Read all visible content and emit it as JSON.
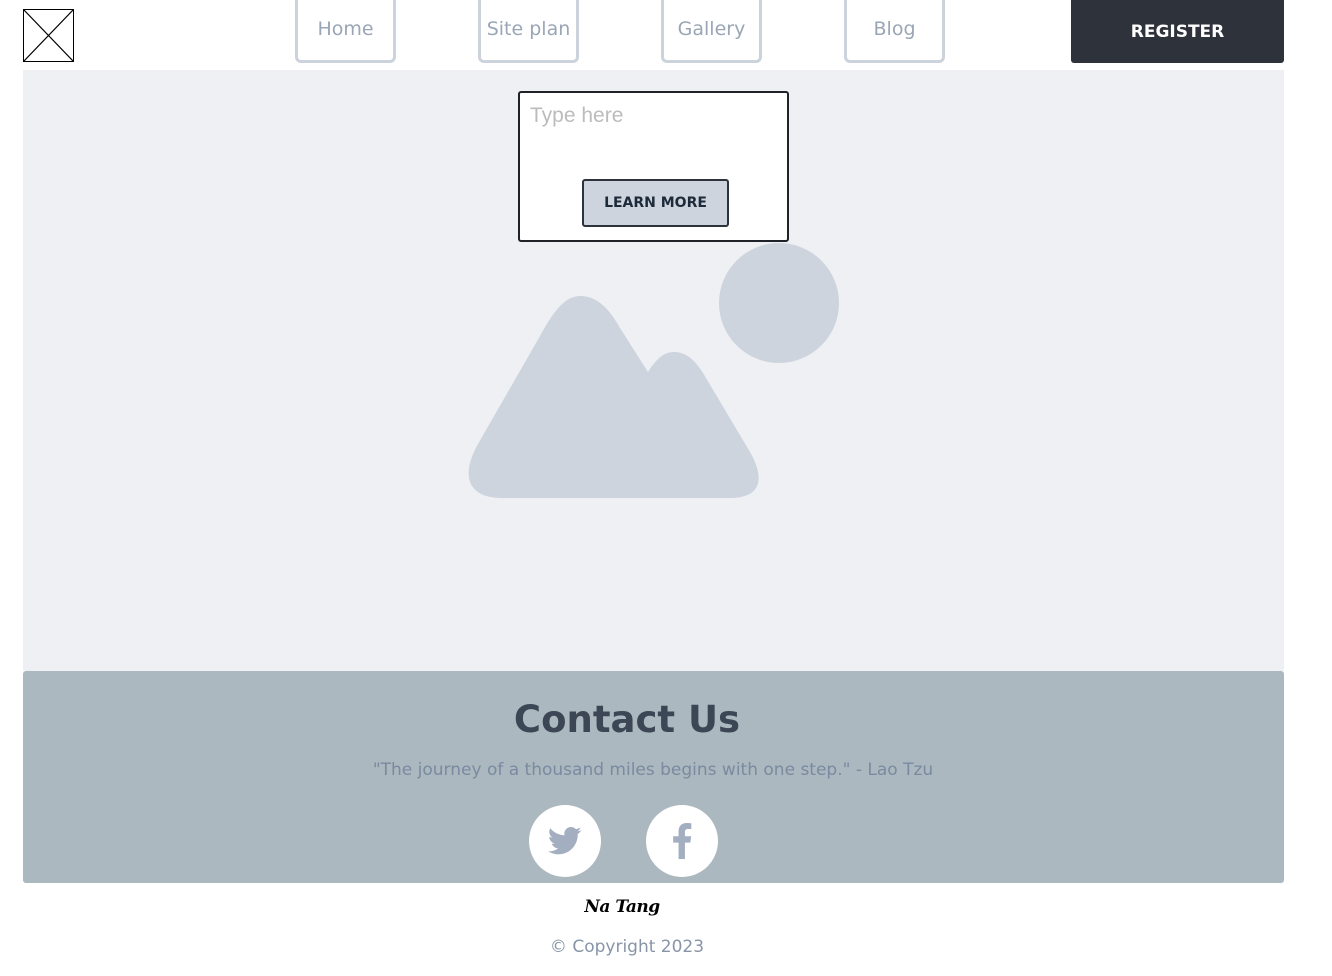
{
  "header": {
    "logo_icon": "image-placeholder-icon",
    "nav": [
      {
        "label": "Home"
      },
      {
        "label": "Site plan"
      },
      {
        "label": "Gallery"
      },
      {
        "label": "Blog"
      }
    ],
    "register_label": "REGISTER"
  },
  "hero": {
    "input_placeholder": "Type here",
    "input_value": "",
    "learn_more_label": "LEARN MORE",
    "image_icon": "mountain-sun-placeholder-icon"
  },
  "contact": {
    "title": "Contact Us",
    "quote": "\"The journey of a thousand miles begins with one step.\" - Lao Tzu",
    "social": [
      {
        "icon": "twitter-icon"
      },
      {
        "icon": "facebook-icon"
      }
    ]
  },
  "footer": {
    "signature": "Na Tang",
    "copyright": "© Copyright 2023"
  },
  "colors": {
    "accent_dark": "#2d323b",
    "hero_bg": "#eef0f4",
    "contact_bg": "#abb8bf",
    "placeholder_gray": "#cdd4dd",
    "nav_text": "#9aa6b6"
  }
}
